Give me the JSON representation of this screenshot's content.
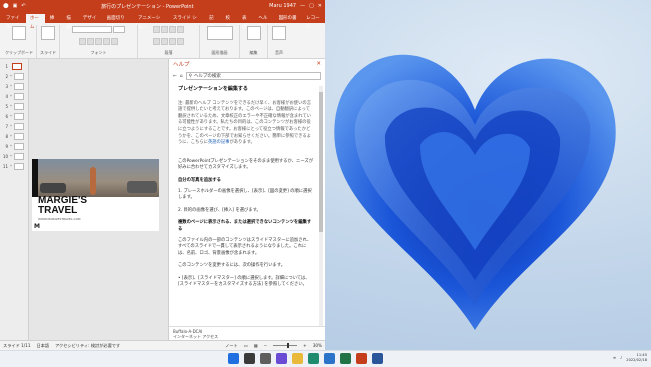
{
  "window": {
    "title": "旅行のプレゼンテーション - PowerPoint",
    "user": "Maru 1947",
    "share": "共有"
  },
  "tabs": [
    "ファイル",
    "ホーム",
    "挿入",
    "描画",
    "デザイン",
    "画面切り替え",
    "アニメーション",
    "スライド ショー",
    "記録",
    "校閲",
    "表示",
    "ヘルプ",
    "図形の書式",
    "ストーリー",
    "レコード",
    "共有"
  ],
  "ribbon_groups": [
    "クリップボード",
    "スライド",
    "フォント",
    "段落",
    "図形描画",
    "編集",
    "音声"
  ],
  "ribbon_buttons": {
    "paste": "貼り付け",
    "new_slide": "新しい\nスライド"
  },
  "slides": [
    {
      "num": "1",
      "star": ""
    },
    {
      "num": "2",
      "star": "*"
    },
    {
      "num": "3",
      "star": "*"
    },
    {
      "num": "4",
      "star": "*"
    },
    {
      "num": "5",
      "star": "*"
    },
    {
      "num": "6",
      "star": "*"
    },
    {
      "num": "7",
      "star": "*"
    },
    {
      "num": "8",
      "star": "*"
    },
    {
      "num": "9",
      "star": "*"
    },
    {
      "num": "10",
      "star": "*"
    },
    {
      "num": "11",
      "star": "*"
    }
  ],
  "slide": {
    "title": "MARGIE'S\nTRAVEL",
    "website": "WWW.MARGIESTRAVEL.COM",
    "extra": "M"
  },
  "help": {
    "pane_title": "ヘルプ",
    "search_placeholder": "ヘルプの検索",
    "article_title": "プレゼンテーションを編集する",
    "note": "注: 最新のヘルプ コンテンツをできるだけ早く、お客様がお使いの言語で提供したいと考えております。このページは、自動翻訳によって翻訳されているため、文章校正のエラーや不正確な情報が含まれている可能性があります。私たちの目的は、このコンテンツがお客様の役に立つようにすることです。お客様にとって役立つ情報であったかどうかを、このページの下部でお知らせください。簡単に参照できるように、こちらに",
    "note_link": "英語の記事",
    "note_tail": "があります。",
    "intro": "このPowerPointプレゼンテーションをそのまま使用するか、ニーズが好みに合わせてカスタマイズします。",
    "sec1": "自分の写真を追加する",
    "step1": "1. プレースホルダーの画像を選択し、[表示]、[図の変更] の順に選択します。",
    "step2": "2. 目的の画像を選び、[挿入] を選びます。",
    "sec2": "複数のページに表示される、または選択できないコンテンツを編集する",
    "p1": "このファイル内の一部のコンテンツはスライドマスターに追加され、すべてのスライドで一貫して表示されるようになりました。これには、名前、ロゴ、背景画像が含まれます。",
    "p2": "このコンテンツを変更するには、次の操作を行います。",
    "bullet": "[表示]、[スライドマスター] の順に選択します。詳細については、[スライドマスターをカスタマイズする方法] を参照してください。",
    "foot1": "Buffalo-A-DCAI",
    "foot2": "インターネット アクセス"
  },
  "status": {
    "slide": "スライド 1/11",
    "lang": "日本語",
    "access": "アクセシビリティ: 検討が必要です",
    "notes": "ノート",
    "zoom": "30%"
  },
  "taskbar": {
    "time": "11:45",
    "date": "2022/02/18"
  },
  "colors": {
    "accent": "#c43e1c",
    "wallpaper_blue": "#1f5fd6"
  }
}
